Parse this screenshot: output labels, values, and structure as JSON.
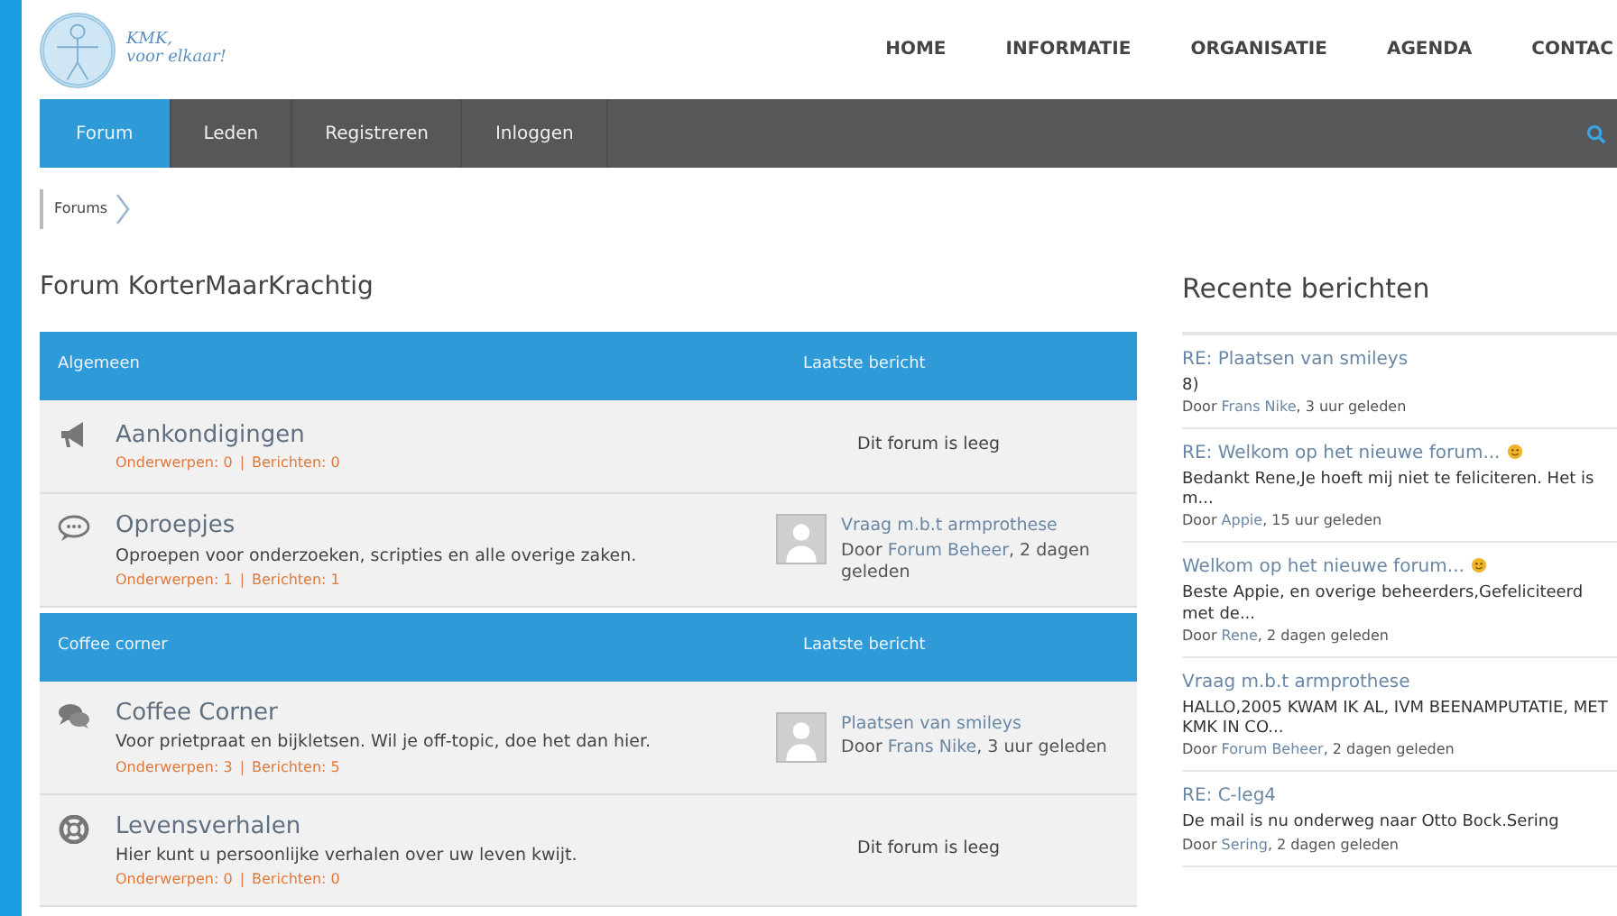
{
  "logo": {
    "line1": "KMK,",
    "line2": "voor elkaar!"
  },
  "top_menu": [
    "HOME",
    "INFORMATIE",
    "ORGANISATIE",
    "AGENDA",
    "CONTAC"
  ],
  "nav": [
    {
      "label": "Forum",
      "selected": true
    },
    {
      "label": "Leden",
      "selected": false
    },
    {
      "label": "Registreren",
      "selected": false
    },
    {
      "label": "Inloggen",
      "selected": false
    }
  ],
  "breadcrumb": [
    "Forums"
  ],
  "title": "Forum KorterMaarKrachtig",
  "sections": [
    {
      "name": "Algemeen",
      "last_header": "Laatste bericht",
      "forums": [
        {
          "kind": "megaphone",
          "title": "Aankondigingen",
          "topics": "Onderwerpen: 0",
          "separator": "|",
          "posts": "Berichten: 0",
          "empty": "Dit forum is leeg"
        },
        {
          "kind": "chat",
          "title": "Oproepjes",
          "description": "Oproepen voor onderzoeken, scripties en alle overige zaken.",
          "topics": "Onderwerpen: 1",
          "separator": "|",
          "posts": "Berichten: 1",
          "last": {
            "title": "Vraag m.b.t armprothese",
            "by": "Door",
            "author": "Forum Beheer",
            "time": ", 2 dagen geleden"
          }
        }
      ]
    },
    {
      "name": "Coffee corner",
      "last_header": "Laatste bericht",
      "forums": [
        {
          "kind": "comments",
          "title": "Coffee Corner",
          "description": "Voor prietpraat en bijkletsen. Wil je off-topic, doe het dan hier.",
          "topics": "Onderwerpen: 3",
          "separator": "|",
          "posts": "Berichten: 5",
          "last": {
            "title": "Plaatsen van smileys",
            "by": "Door",
            "author": "Frans Nike",
            "time": ", 3 uur geleden"
          }
        },
        {
          "kind": "lifebuoy",
          "title": "Levensverhalen",
          "description": "Hier kunt u persoonlijke verhalen over uw leven kwijt.",
          "topics": "Onderwerpen: 0",
          "separator": "|",
          "posts": "Berichten: 0",
          "empty": "Dit forum is leeg"
        }
      ]
    }
  ],
  "recent": {
    "title": "Recente berichten",
    "posts": [
      {
        "title": "RE: Plaatsen van smileys",
        "smiley": false,
        "excerpt": "8)",
        "by": "Door",
        "author": "Frans Nike",
        "time": ", 3 uur  geleden"
      },
      {
        "title": "RE: Welkom op het nieuwe forum...",
        "smiley": true,
        "excerpt": "Bedankt Rene,Je hoeft mij niet te feliciteren. Het is m...",
        "by": "Door",
        "author": "Appie",
        "time": ", 15 uur  geleden"
      },
      {
        "title": "Welkom op het nieuwe forum...",
        "smiley": true,
        "excerpt": "Beste Appie, en overige beheerders,Gefeliciteerd met de...",
        "by": "Door",
        "author": "Rene",
        "time": ", 2 dagen  geleden"
      },
      {
        "title": "Vraag m.b.t armprothese",
        "smiley": false,
        "excerpt": "HALLO,2005 KWAM IK AL, IVM BEENAMPUTATIE, MET KMK IN CO...",
        "by": "Door",
        "author": "Forum Beheer",
        "time": ", 2 dagen  geleden"
      },
      {
        "title": "RE: C-leg4",
        "smiley": false,
        "excerpt": "De mail is nu onderweg naar Otto Bock.Sering",
        "by": "Door",
        "author": "Sering",
        "time": ", 2 dagen  geleden"
      }
    ]
  }
}
